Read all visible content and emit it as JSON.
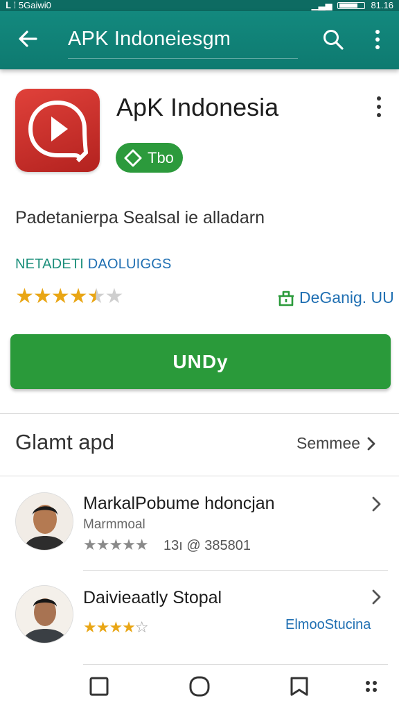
{
  "status_bar": {
    "left_text": "𝐋 ⁞ 5Gaiwi0",
    "right_text": "81.16"
  },
  "app_bar": {
    "title": "APK Indoneiesgm"
  },
  "app": {
    "name": "ApK Indonesia",
    "badge_label": "Tbo",
    "description": "Padetanierpa Sealsal ie alladarn",
    "category_primary": "NETADETI",
    "category_secondary": "DAOLUIGGS",
    "rating": 4.5,
    "rating_display": "★★★★",
    "rating_half": "★",
    "rating_empty": "★",
    "developer": "DeGanig. UU",
    "install_label": "UNDy"
  },
  "section": {
    "title": "Glamt apd",
    "see_more": "Semmee"
  },
  "list": [
    {
      "title": "MarkalPobume hdoncjan",
      "subtitle": "Marmmoal",
      "stars": "★★★★★",
      "meta": "13ı @ 385801"
    },
    {
      "title": "Daivieaatly Stopal",
      "stars_filled": "★★★★",
      "stars_empty": "☆",
      "link": "ElmooStucina"
    }
  ],
  "colors": {
    "primary": "#13897e",
    "install": "#2a9a3a",
    "star": "#e9a615",
    "link": "#1f6fb2"
  },
  "icons": [
    "back-arrow-icon",
    "search-icon",
    "overflow-menu-icon",
    "play-icon",
    "shield-icon",
    "developer-icon",
    "chevron-right-icon",
    "square-nav-icon",
    "circle-nav-icon",
    "bookmark-nav-icon",
    "apps-grid-icon"
  ]
}
